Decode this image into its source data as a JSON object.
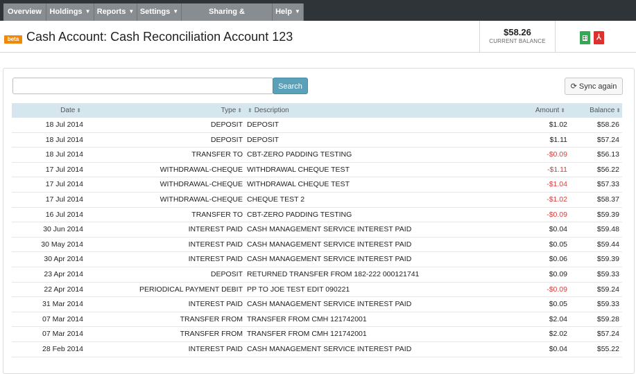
{
  "nav": [
    {
      "label": "Overview",
      "caret": false
    },
    {
      "label": "Holdings",
      "caret": true
    },
    {
      "label": "Reports",
      "caret": true
    },
    {
      "label": "Settings",
      "caret": true
    },
    {
      "label": "Sharing & Permissions",
      "caret": true
    },
    {
      "label": "Help",
      "caret": true
    }
  ],
  "header": {
    "badge": "beta",
    "title": "Cash Account: Cash Reconciliation Account 123",
    "balance_amount": "$58.26",
    "balance_label": "CURRENT BALANCE",
    "export_icons": [
      "spreadsheet-icon",
      "pdf-icon"
    ]
  },
  "toolbar": {
    "search_value": "",
    "search_button": "Search",
    "sync_button": "Sync again",
    "sync_icon": "refresh-icon"
  },
  "table": {
    "headers": {
      "date": "Date",
      "type": "Type",
      "description": "Description",
      "amount": "Amount",
      "balance": "Balance"
    },
    "rows": [
      {
        "date": "18 Jul 2014",
        "type": "DEPOSIT",
        "description": "DEPOSIT",
        "amount": "$1.02",
        "balance": "$58.26",
        "negative": false
      },
      {
        "date": "18 Jul 2014",
        "type": "DEPOSIT",
        "description": "DEPOSIT",
        "amount": "$1.11",
        "balance": "$57.24",
        "negative": false
      },
      {
        "date": "18 Jul 2014",
        "type": "TRANSFER TO",
        "description": "CBT-ZERO PADDING TESTING",
        "amount": "-$0.09",
        "balance": "$56.13",
        "negative": true
      },
      {
        "date": "17 Jul 2014",
        "type": "WITHDRAWAL-CHEQUE",
        "description": "WITHDRAWAL CHEQUE TEST",
        "amount": "-$1.11",
        "balance": "$56.22",
        "negative": true
      },
      {
        "date": "17 Jul 2014",
        "type": "WITHDRAWAL-CHEQUE",
        "description": "WITHDRAWAL CHEQUE TEST",
        "amount": "-$1.04",
        "balance": "$57.33",
        "negative": true
      },
      {
        "date": "17 Jul 2014",
        "type": "WITHDRAWAL-CHEQUE",
        "description": "CHEQUE TEST 2",
        "amount": "-$1.02",
        "balance": "$58.37",
        "negative": true
      },
      {
        "date": "16 Jul 2014",
        "type": "TRANSFER TO",
        "description": "CBT-ZERO PADDING TESTING",
        "amount": "-$0.09",
        "balance": "$59.39",
        "negative": true
      },
      {
        "date": "30 Jun 2014",
        "type": "INTEREST PAID",
        "description": "CASH MANAGEMENT SERVICE INTEREST PAID",
        "amount": "$0.04",
        "balance": "$59.48",
        "negative": false
      },
      {
        "date": "30 May 2014",
        "type": "INTEREST PAID",
        "description": "CASH MANAGEMENT SERVICE INTEREST PAID",
        "amount": "$0.05",
        "balance": "$59.44",
        "negative": false
      },
      {
        "date": "30 Apr 2014",
        "type": "INTEREST PAID",
        "description": "CASH MANAGEMENT SERVICE INTEREST PAID",
        "amount": "$0.06",
        "balance": "$59.39",
        "negative": false
      },
      {
        "date": "23 Apr 2014",
        "type": "DEPOSIT",
        "description": "RETURNED TRANSFER FROM 182-222 000121741",
        "amount": "$0.09",
        "balance": "$59.33",
        "negative": false
      },
      {
        "date": "22 Apr 2014",
        "type": "PERIODICAL PAYMENT DEBIT",
        "description": "PP TO JOE TEST EDIT 090221",
        "amount": "-$0.09",
        "balance": "$59.24",
        "negative": true
      },
      {
        "date": "31 Mar 2014",
        "type": "INTEREST PAID",
        "description": "CASH MANAGEMENT SERVICE INTEREST PAID",
        "amount": "$0.05",
        "balance": "$59.33",
        "negative": false
      },
      {
        "date": "07 Mar 2014",
        "type": "TRANSFER FROM",
        "description": "TRANSFER FROM CMH 121742001",
        "amount": "$2.04",
        "balance": "$59.28",
        "negative": false
      },
      {
        "date": "07 Mar 2014",
        "type": "TRANSFER FROM",
        "description": "TRANSFER FROM CMH 121742001",
        "amount": "$2.02",
        "balance": "$57.24",
        "negative": false
      },
      {
        "date": "28 Feb 2014",
        "type": "INTEREST PAID",
        "description": "CASH MANAGEMENT SERVICE INTEREST PAID",
        "amount": "$0.04",
        "balance": "$55.22",
        "negative": false
      }
    ]
  },
  "colors": {
    "nav_bg": "#2f3438",
    "nav_button": "#888d91",
    "accent": "#5aa0b8",
    "beta_badge": "#f0890a",
    "negative": "#d43f3a",
    "table_header": "#d5e6ee"
  }
}
